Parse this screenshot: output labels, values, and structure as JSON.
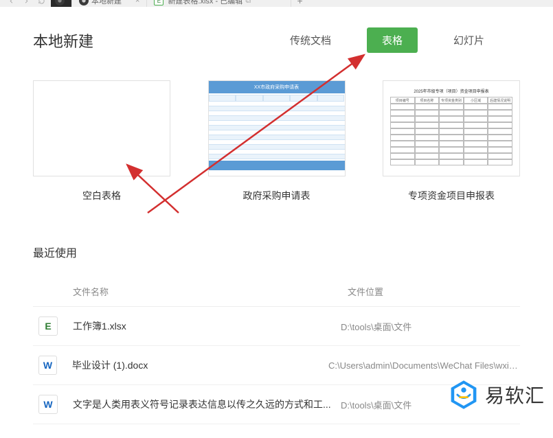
{
  "nav": {
    "back": "←",
    "forward": "→",
    "reload": "↻"
  },
  "tabs": [
    {
      "icon": "home-dark",
      "label": "",
      "active": true
    },
    {
      "icon": "home-dark",
      "label": "本地新建",
      "active": false,
      "closable": true
    },
    {
      "icon": "excel",
      "label": "新建表格.xlsx - 已编辑",
      "active": false,
      "window_icon": true
    }
  ],
  "page_title": "本地新建",
  "doc_types": [
    {
      "key": "doc",
      "label": "传统文档",
      "active": false
    },
    {
      "key": "sheet",
      "label": "表格",
      "active": true
    },
    {
      "key": "slide",
      "label": "幻灯片",
      "active": false
    }
  ],
  "templates": [
    {
      "key": "blank",
      "label": "空白表格"
    },
    {
      "key": "gov",
      "label": "政府采购申请表",
      "thumb_title": "XX市政府采购申请表"
    },
    {
      "key": "fund",
      "label": "专项资金项目申报表",
      "thumb_title": "2025年市级专项（项目）资金项目申报表",
      "cols": [
        "项目编号",
        "项目名称",
        "专项资金类别",
        "小区域",
        "后建情况说明"
      ]
    }
  ],
  "recent": {
    "title": "最近使用",
    "headers": {
      "name": "文件名称",
      "location": "文件位置"
    },
    "rows": [
      {
        "icon": "E",
        "iconType": "excel",
        "name": "工作簿1.xlsx",
        "location": "D:\\tools\\桌面\\文件"
      },
      {
        "icon": "W",
        "iconType": "word",
        "name": "毕业设计 (1).docx",
        "location": "C:\\Users\\admin\\Documents\\WeChat Files\\wxid_gn"
      },
      {
        "icon": "W",
        "iconType": "word",
        "name": "文字是人类用表义符号记录表达信息以传之久远的方式和工...",
        "location": "D:\\tools\\桌面\\文件"
      }
    ]
  },
  "watermark": {
    "text": "易软汇"
  }
}
